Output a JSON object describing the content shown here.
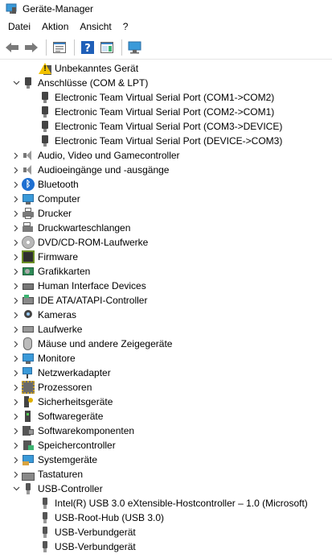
{
  "window": {
    "title": "Geräte-Manager"
  },
  "menu": {
    "items": [
      "Datei",
      "Aktion",
      "Ansicht",
      "?"
    ]
  },
  "toolbar": {
    "buttons": [
      "back-arrow-icon",
      "forward-arrow-icon",
      "properties-icon",
      "help-icon",
      "action-pane-icon",
      "scan-monitor-icon"
    ]
  },
  "tree": {
    "nodes": [
      {
        "label": "Unbekanntes Gerät",
        "icon": "warning-device-icon",
        "level": 1,
        "chevron": ""
      },
      {
        "label": "Anschlüsse (COM & LPT)",
        "icon": "port-icon",
        "level": 0,
        "chevron": "expanded"
      },
      {
        "label": "Electronic Team Virtual Serial Port (COM1->COM2)",
        "icon": "port-icon",
        "level": 1,
        "chevron": ""
      },
      {
        "label": "Electronic Team Virtual Serial Port (COM2->COM1)",
        "icon": "port-icon",
        "level": 1,
        "chevron": ""
      },
      {
        "label": "Electronic Team Virtual Serial Port (COM3->DEVICE)",
        "icon": "port-icon",
        "level": 1,
        "chevron": ""
      },
      {
        "label": "Electronic Team Virtual Serial Port (DEVICE->COM3)",
        "icon": "port-icon",
        "level": 1,
        "chevron": ""
      },
      {
        "label": "Audio, Video und Gamecontroller",
        "icon": "speaker-icon",
        "level": 0,
        "chevron": "collapsed"
      },
      {
        "label": "Audioeingänge und -ausgänge",
        "icon": "speaker-icon",
        "level": 0,
        "chevron": "collapsed"
      },
      {
        "label": "Bluetooth",
        "icon": "bluetooth-icon",
        "level": 0,
        "chevron": "collapsed"
      },
      {
        "label": "Computer",
        "icon": "computer-icon",
        "level": 0,
        "chevron": "collapsed"
      },
      {
        "label": "Drucker",
        "icon": "printer-icon",
        "level": 0,
        "chevron": "collapsed"
      },
      {
        "label": "Druckwarteschlangen",
        "icon": "print-queue-icon",
        "level": 0,
        "chevron": "collapsed"
      },
      {
        "label": "DVD/CD-ROM-Laufwerke",
        "icon": "disc-icon",
        "level": 0,
        "chevron": "collapsed"
      },
      {
        "label": "Firmware",
        "icon": "firmware-chip-icon",
        "level": 0,
        "chevron": "collapsed"
      },
      {
        "label": "Grafikkarten",
        "icon": "graphics-card-icon",
        "level": 0,
        "chevron": "collapsed"
      },
      {
        "label": "Human Interface Devices",
        "icon": "hid-icon",
        "level": 0,
        "chevron": "collapsed"
      },
      {
        "label": "IDE ATA/ATAPI-Controller",
        "icon": "ide-controller-icon",
        "level": 0,
        "chevron": "collapsed"
      },
      {
        "label": "Kameras",
        "icon": "camera-icon",
        "level": 0,
        "chevron": "collapsed"
      },
      {
        "label": "Laufwerke",
        "icon": "drive-icon",
        "level": 0,
        "chevron": "collapsed"
      },
      {
        "label": "Mäuse und andere Zeigegeräte",
        "icon": "mouse-icon",
        "level": 0,
        "chevron": "collapsed"
      },
      {
        "label": "Monitore",
        "icon": "monitor-icon",
        "level": 0,
        "chevron": "collapsed"
      },
      {
        "label": "Netzwerkadapter",
        "icon": "network-adapter-icon",
        "level": 0,
        "chevron": "collapsed"
      },
      {
        "label": "Prozessoren",
        "icon": "processor-icon",
        "level": 0,
        "chevron": "collapsed"
      },
      {
        "label": "Sicherheitsgeräte",
        "icon": "security-device-icon",
        "level": 0,
        "chevron": "collapsed"
      },
      {
        "label": "Softwaregeräte",
        "icon": "software-device-icon",
        "level": 0,
        "chevron": "collapsed"
      },
      {
        "label": "Softwarekomponenten",
        "icon": "software-component-icon",
        "level": 0,
        "chevron": "collapsed"
      },
      {
        "label": "Speichercontroller",
        "icon": "storage-controller-icon",
        "level": 0,
        "chevron": "collapsed"
      },
      {
        "label": "Systemgeräte",
        "icon": "system-device-icon",
        "level": 0,
        "chevron": "collapsed"
      },
      {
        "label": "Tastaturen",
        "icon": "keyboard-icon",
        "level": 0,
        "chevron": "collapsed"
      },
      {
        "label": "USB-Controller",
        "icon": "usb-icon",
        "level": 0,
        "chevron": "expanded"
      },
      {
        "label": "Intel(R) USB 3.0 eXtensible-Hostcontroller – 1.0 (Microsoft)",
        "icon": "usb-icon",
        "level": 1,
        "chevron": ""
      },
      {
        "label": "USB-Root-Hub (USB 3.0)",
        "icon": "usb-icon",
        "level": 1,
        "chevron": ""
      },
      {
        "label": "USB-Verbundgerät",
        "icon": "usb-icon",
        "level": 1,
        "chevron": ""
      },
      {
        "label": "USB-Verbundgerät",
        "icon": "usb-icon",
        "level": 1,
        "chevron": ""
      }
    ]
  }
}
